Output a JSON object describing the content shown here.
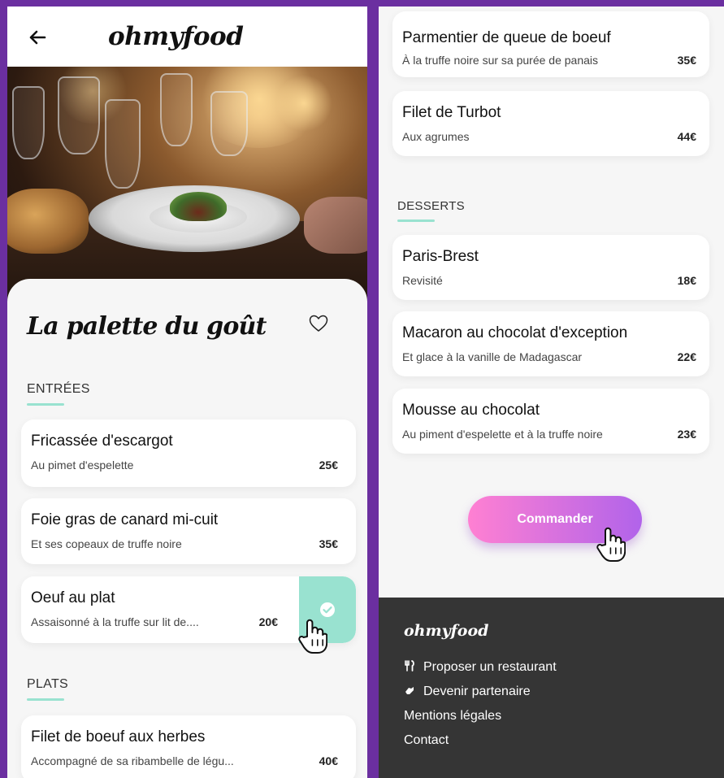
{
  "app": {
    "brand": "ohmyfood"
  },
  "restaurant": {
    "name": "La palette du goût"
  },
  "sections": {
    "entrees": "ENTRÉES",
    "plats": "PLATS",
    "desserts": "DESSERTS"
  },
  "entrees": [
    {
      "name": "Fricassée d'escargot",
      "desc": "Au pimet d'espelette",
      "price": "25€"
    },
    {
      "name": "Foie gras de canard mi-cuit",
      "desc": "Et ses copeaux de truffe noire",
      "price": "35€"
    },
    {
      "name": "Oeuf au plat",
      "desc": "Assaisonné à la truffe sur lit de....",
      "price": "20€"
    }
  ],
  "plats": [
    {
      "name": "Filet de boeuf aux herbes",
      "desc": "Accompagné de sa ribambelle de légu...",
      "price": "40€"
    },
    {
      "name": "Parmentier de queue de boeuf",
      "desc": "À la truffe noire sur sa purée de panais",
      "price": "35€"
    },
    {
      "name": "Filet de Turbot",
      "desc": "Aux agrumes",
      "price": "44€"
    }
  ],
  "desserts": [
    {
      "name": "Paris-Brest",
      "desc": "Revisité",
      "price": "18€"
    },
    {
      "name": "Macaron au chocolat d'exception",
      "desc": "Et glace à la vanille de Madagascar",
      "price": "22€"
    },
    {
      "name": "Mousse au chocolat",
      "desc": "Au piment d'espelette et à la truffe noire",
      "price": "23€"
    }
  ],
  "order_button": "Commander",
  "footer": {
    "brand": "ohmyfood",
    "links": [
      "Proposer un restaurant",
      "Devenir partenaire",
      "Mentions légales",
      "Contact"
    ]
  },
  "colors": {
    "page_background": "#6b2fa0",
    "accent_mint": "#99e2d0",
    "button_gradient_start": "#ff80d2",
    "button_gradient_end": "#b163ea",
    "footer_background": "#353535"
  },
  "icons": [
    "back-arrow-icon",
    "heart-icon",
    "check-icon",
    "hand-pointer-icon",
    "utensils-icon",
    "handshake-icon"
  ]
}
